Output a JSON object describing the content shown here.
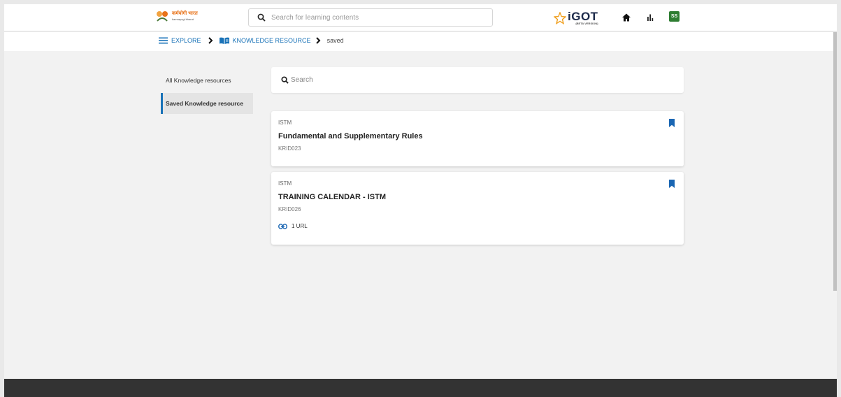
{
  "header": {
    "logo_text": "कर्मयोगी भारत",
    "logo_subtext": "karmayogi bharat",
    "search_placeholder": "Search for learning contents",
    "brand": "iGOT",
    "brand_sub": "(BETA VERSION)",
    "avatar_initials": "SS",
    "icons": [
      "home-icon",
      "bar-chart-icon"
    ]
  },
  "breadcrumb": {
    "explore": "EXPLORE",
    "knowledge_resource": "KNOWLEDGE RESOURCE",
    "current": "saved"
  },
  "sidebar": {
    "items": [
      {
        "label": "All Knowledge resources",
        "active": false
      },
      {
        "label": "Saved Knowledge resource",
        "active": true
      }
    ]
  },
  "main": {
    "search_placeholder": "Search",
    "cards": [
      {
        "org": "ISTM",
        "title": "Fundamental and Supplementary Rules",
        "code": "KRID023",
        "bookmarked": true
      },
      {
        "org": "ISTM",
        "title": "TRAINING CALENDAR - ISTM",
        "code": "KRID026",
        "url_count_label": "1 URL",
        "bookmarked": true
      }
    ]
  },
  "colors": {
    "accent": "#1a73b8",
    "avatar_bg": "#2e7d32",
    "footer": "#333333"
  }
}
